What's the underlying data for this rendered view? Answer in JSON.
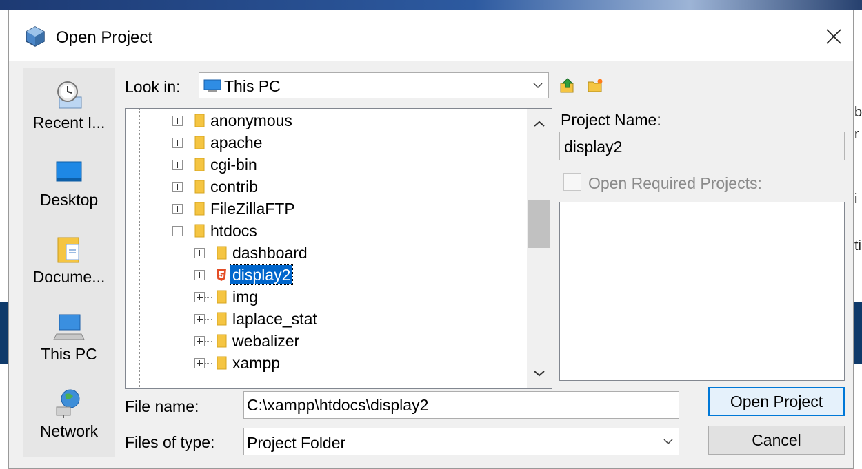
{
  "dialog": {
    "title": "Open Project",
    "close_symbol": "✕"
  },
  "places": [
    {
      "label": "Recent I...",
      "icon": "recent-items-icon"
    },
    {
      "label": "Desktop",
      "icon": "desktop-icon"
    },
    {
      "label": "Docume...",
      "icon": "documents-icon"
    },
    {
      "label": "This PC",
      "icon": "this-pc-icon"
    },
    {
      "label": "Network",
      "icon": "network-icon"
    }
  ],
  "look_in": {
    "label": "Look in:",
    "value": "This PC"
  },
  "tree": [
    {
      "label": "anonymous",
      "level": 1,
      "state": "collapsed",
      "type": "folder"
    },
    {
      "label": "apache",
      "level": 1,
      "state": "collapsed",
      "type": "folder"
    },
    {
      "label": "cgi-bin",
      "level": 1,
      "state": "collapsed",
      "type": "folder"
    },
    {
      "label": "contrib",
      "level": 1,
      "state": "collapsed",
      "type": "folder"
    },
    {
      "label": "FileZillaFTP",
      "level": 1,
      "state": "collapsed",
      "type": "folder"
    },
    {
      "label": "htdocs",
      "level": 1,
      "state": "expanded",
      "type": "folder"
    },
    {
      "label": "dashboard",
      "level": 2,
      "state": "collapsed",
      "type": "folder"
    },
    {
      "label": "display2",
      "level": 2,
      "state": "collapsed",
      "type": "html5-project",
      "selected": true
    },
    {
      "label": "img",
      "level": 2,
      "state": "collapsed",
      "type": "folder"
    },
    {
      "label": "laplace_stat",
      "level": 2,
      "state": "collapsed",
      "type": "folder"
    },
    {
      "label": "webalizer",
      "level": 2,
      "state": "collapsed",
      "type": "folder"
    },
    {
      "label": "xampp",
      "level": 2,
      "state": "collapsed",
      "type": "folder"
    }
  ],
  "project": {
    "name_label": "Project Name:",
    "name_value": "display2",
    "required_label": "Open Required Projects:",
    "required_checked": false
  },
  "file_name": {
    "label": "File name:",
    "value": "C:\\xampp\\htdocs\\display2"
  },
  "file_type": {
    "label": "Files of type:",
    "value": "Project Folder"
  },
  "buttons": {
    "open": "Open Project",
    "cancel": "Cancel"
  },
  "background_fragments": [
    "b",
    "r",
    "i",
    "ti"
  ],
  "colors": {
    "selection": "#0066cc",
    "folder": "#f5c542",
    "html5": "#e44d26",
    "default_button_border": "#0078d7"
  }
}
